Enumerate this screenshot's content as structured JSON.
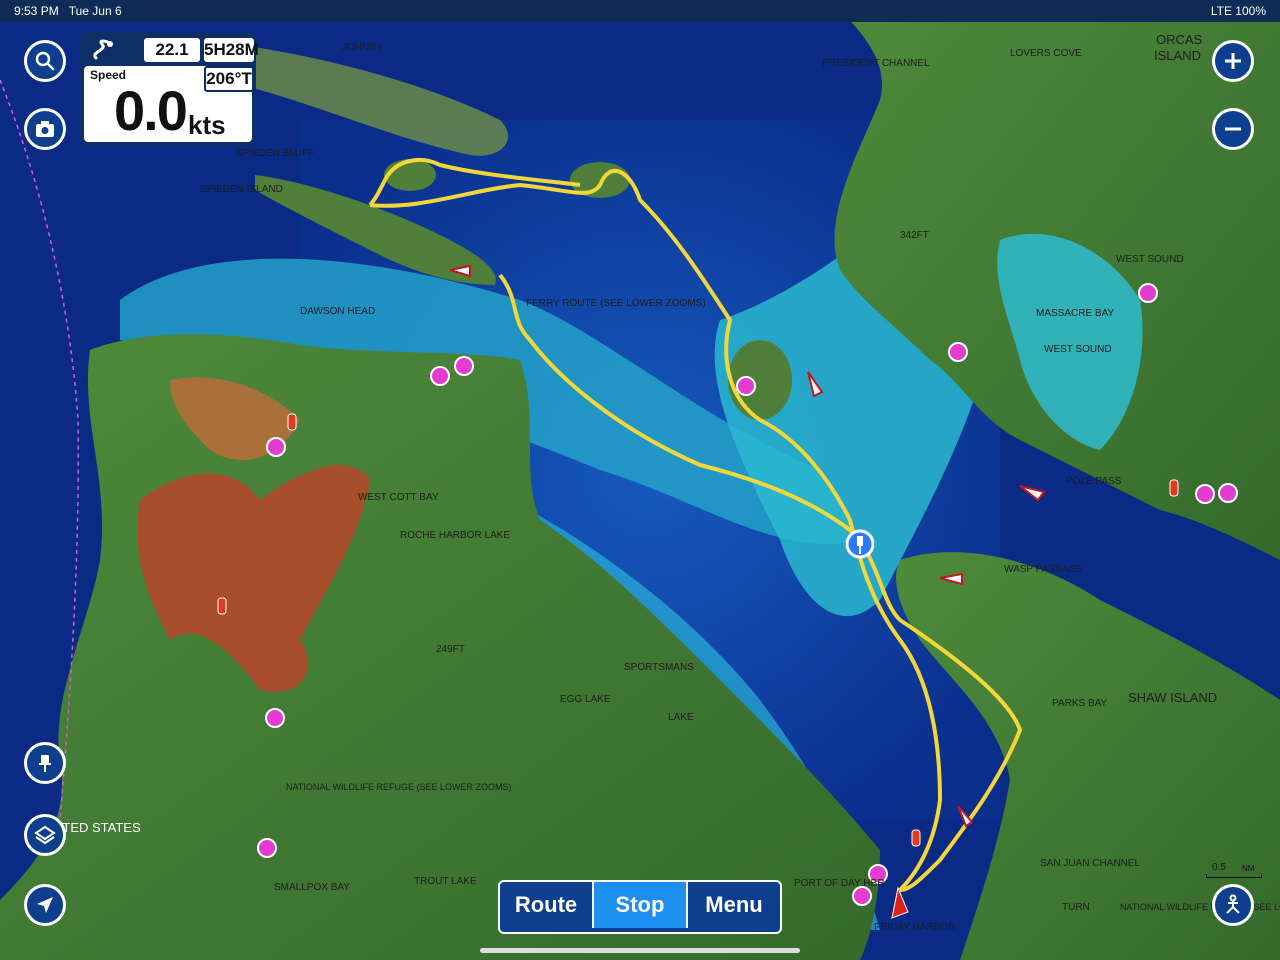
{
  "status_bar": {
    "time": "9:53 PM",
    "date": "Tue Jun 6",
    "signal": "LTE 100%"
  },
  "nav_panel": {
    "distance": "22.1 NM",
    "time_remaining": "5H28M",
    "speed_label": "Speed",
    "speed_value": "0.0",
    "speed_unit": "kts",
    "course": "206°T"
  },
  "bottom_menu": {
    "route": "Route",
    "stop": "Stop",
    "menu": "Menu",
    "active": "Stop"
  },
  "scale": {
    "value": "0.5",
    "unit": "NM"
  },
  "map_labels": [
    {
      "text": "JOHNS I",
      "color": "#1d1d1d"
    },
    {
      "text": "PRESIDENT CHANNEL",
      "color": "#1d1d1d"
    },
    {
      "text": "LOVERS COVE",
      "color": "#1d1d1d"
    },
    {
      "text": "ORCAS",
      "color": "#1d1d1d"
    },
    {
      "text": "ISLAND",
      "color": "#1d1d1d"
    },
    {
      "text": "SPIEDEN BLUFF",
      "color": "#1d1d1d"
    },
    {
      "text": "SPIEDEN ISLAND",
      "color": "#1d1d1d"
    },
    {
      "text": "WEST SOUND",
      "color": "#1d1d1d"
    },
    {
      "text": "MASSACRE BAY",
      "color": "#1d1d1d"
    },
    {
      "text": "WEST SOUND",
      "color": "#1d1d1d"
    },
    {
      "text": "DAWSON HEAD",
      "color": "#1d1d1d"
    },
    {
      "text": "FERRY ROUTE (SEE LOWER ZOOMS)",
      "color": "#1d1d1d"
    },
    {
      "text": "WEST COTT BAY",
      "color": "#1d1d1d"
    },
    {
      "text": "ROCHE HARBOR LAKE",
      "color": "#1d1d1d"
    },
    {
      "text": "POLE PASS",
      "color": "#1d1d1d"
    },
    {
      "text": "WASP PASSAGE",
      "color": "#1d1d1d"
    },
    {
      "text": "SPORTSMANS",
      "color": "#1d1d1d"
    },
    {
      "text": "EGG LAKE",
      "color": "#1d1d1d"
    },
    {
      "text": "LAKE",
      "color": "#1d1d1d"
    },
    {
      "text": "PARKS BAY",
      "color": "#1d1d1d"
    },
    {
      "text": "SHAW ISLAND",
      "color": "#1d1d1d"
    },
    {
      "text": "NATIONAL WILDLIFE REFUGE (SEE LOWER ZOOMS)",
      "color": "#1d1d1d"
    },
    {
      "text": "UNITED STATES",
      "color": "#ffffff"
    },
    {
      "text": "SAN JUAN CHANNEL",
      "color": "#1d1d1d"
    },
    {
      "text": "SMALLPOX BAY",
      "color": "#1d1d1d"
    },
    {
      "text": "TROUT LAKE",
      "color": "#1d1d1d"
    },
    {
      "text": "PORT OF DAY HBR",
      "color": "#1d1d1d"
    },
    {
      "text": "FRIDAY HARBOR",
      "color": "#1d1d1d"
    },
    {
      "text": "TURN",
      "color": "#1d1d1d"
    },
    {
      "text": "NATIONAL WILDLIFE REFUGE (SEE LOWER ZOOMS)",
      "color": "#1d1d1d"
    },
    {
      "text": "342FT",
      "color": "#1d1d1d"
    },
    {
      "text": "249FT",
      "color": "#1d1d1d"
    }
  ],
  "colors": {
    "deep_water": "#0c3aa8",
    "mid_water": "#1b6fd6",
    "shallow_water": "#2fb3d0",
    "land": "#3f7a32",
    "track": "#f2d73a",
    "ui_blue": "#0d3f8e",
    "ui_active": "#1c8ff0"
  },
  "icons": [
    "search-icon",
    "camera-icon",
    "zoom-in-icon",
    "zoom-out-icon",
    "pin-icon",
    "layers-icon",
    "location-arrow-icon",
    "anchor-person-icon",
    "boat-position-icon",
    "waypoint-pin-icon"
  ]
}
